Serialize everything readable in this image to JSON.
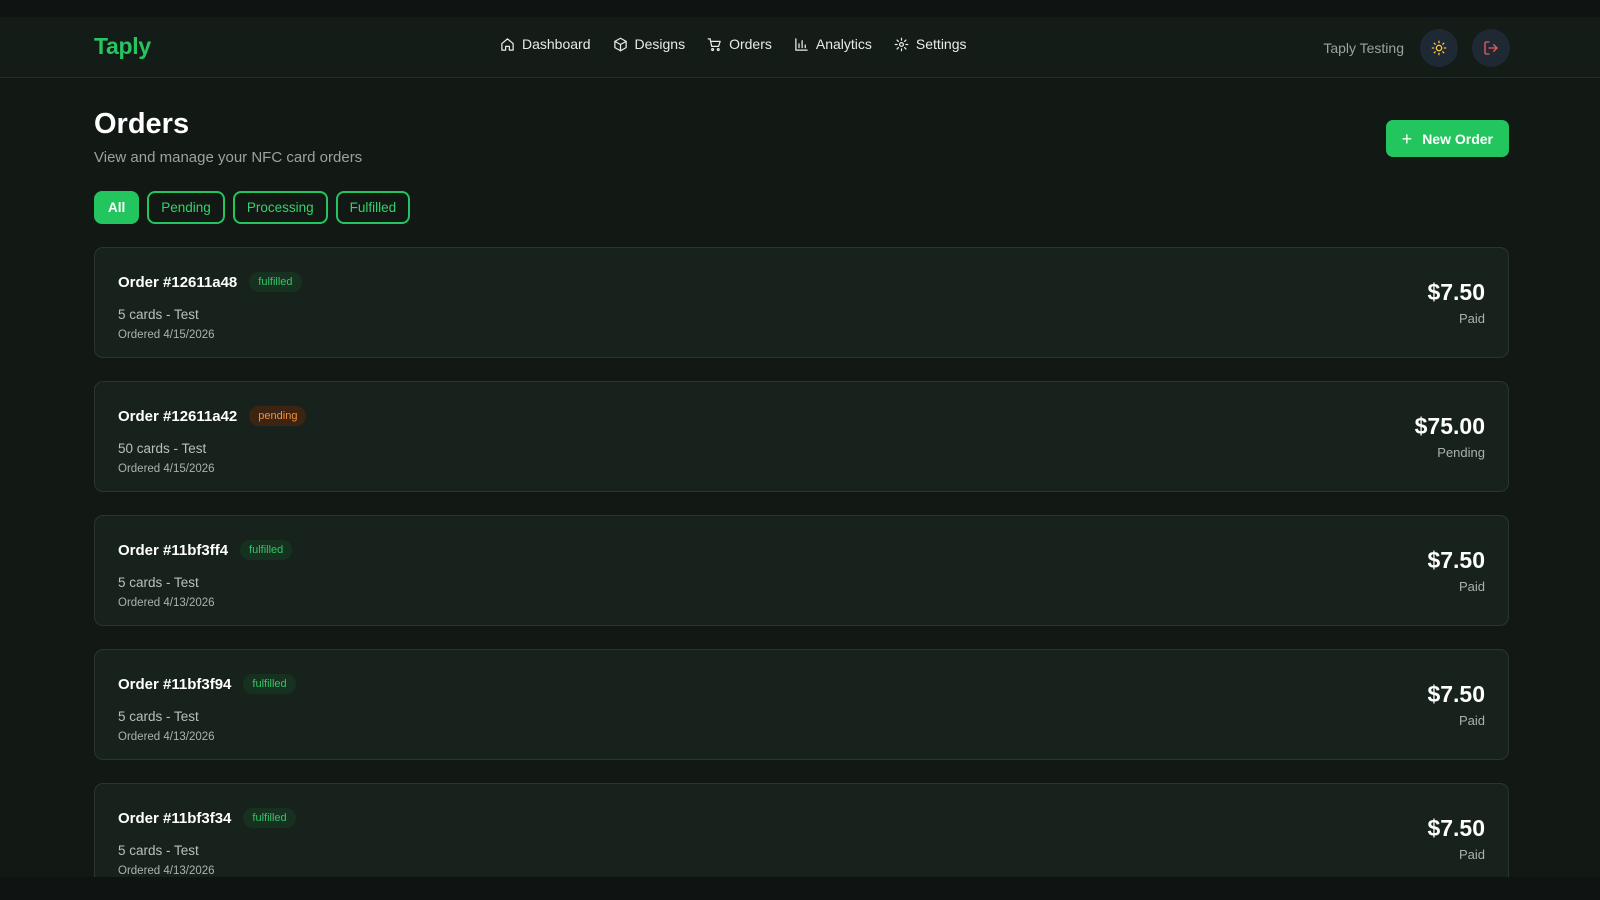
{
  "nav": {
    "brand": "Taply",
    "items": [
      {
        "label": "Dashboard",
        "icon": "home-icon"
      },
      {
        "label": "Designs",
        "icon": "box-icon"
      },
      {
        "label": "Orders",
        "icon": "cart-icon"
      },
      {
        "label": "Analytics",
        "icon": "bar-chart-icon"
      },
      {
        "label": "Settings",
        "icon": "gear-icon"
      }
    ],
    "user_name": "Taply Testing",
    "theme_icon": "sun-icon",
    "logout_icon": "logout-icon"
  },
  "page": {
    "title": "Orders",
    "subtitle": "View and manage your NFC card orders",
    "new_order_label": "New Order"
  },
  "filters": [
    {
      "label": "All",
      "active": true
    },
    {
      "label": "Pending",
      "active": false
    },
    {
      "label": "Processing",
      "active": false
    },
    {
      "label": "Fulfilled",
      "active": false
    }
  ],
  "orders": [
    {
      "id": "Order #12611a48",
      "status": "fulfilled",
      "desc": "5 cards - Test",
      "date": "Ordered 4/15/2026",
      "amount": "$7.50",
      "payment": "Paid"
    },
    {
      "id": "Order #12611a42",
      "status": "pending",
      "desc": "50 cards - Test",
      "date": "Ordered 4/15/2026",
      "amount": "$75.00",
      "payment": "Pending"
    },
    {
      "id": "Order #11bf3ff4",
      "status": "fulfilled",
      "desc": "5 cards - Test",
      "date": "Ordered 4/13/2026",
      "amount": "$7.50",
      "payment": "Paid"
    },
    {
      "id": "Order #11bf3f94",
      "status": "fulfilled",
      "desc": "5 cards - Test",
      "date": "Ordered 4/13/2026",
      "amount": "$7.50",
      "payment": "Paid"
    },
    {
      "id": "Order #11bf3f34",
      "status": "fulfilled",
      "desc": "5 cards - Test",
      "date": "Ordered 4/13/2026",
      "amount": "$7.50",
      "payment": "Paid"
    }
  ],
  "colors": {
    "accent": "#22c55e",
    "background": "#121814",
    "card": "#18221d",
    "pending_badge": "#f0913a"
  }
}
